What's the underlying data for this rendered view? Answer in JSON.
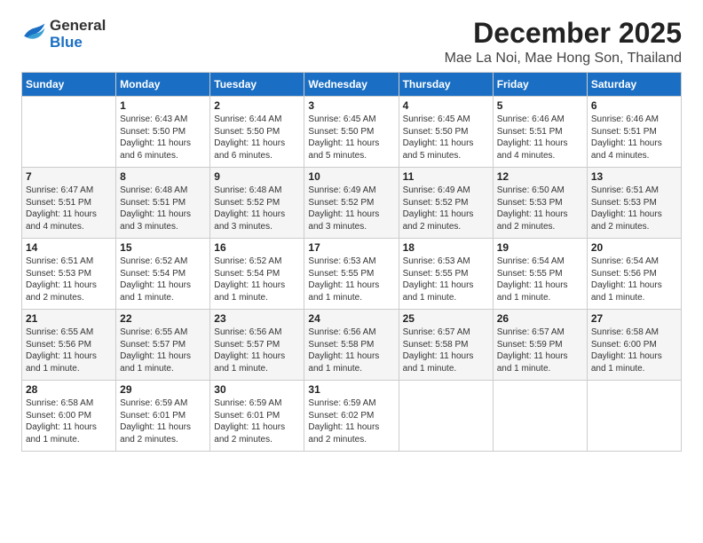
{
  "logo": {
    "general": "General",
    "blue": "Blue"
  },
  "title": "December 2025",
  "location": "Mae La Noi, Mae Hong Son, Thailand",
  "headers": [
    "Sunday",
    "Monday",
    "Tuesday",
    "Wednesday",
    "Thursday",
    "Friday",
    "Saturday"
  ],
  "weeks": [
    [
      {
        "day": "",
        "sunrise": "",
        "sunset": "",
        "daylight": ""
      },
      {
        "day": "1",
        "sunrise": "Sunrise: 6:43 AM",
        "sunset": "Sunset: 5:50 PM",
        "daylight": "Daylight: 11 hours and 6 minutes."
      },
      {
        "day": "2",
        "sunrise": "Sunrise: 6:44 AM",
        "sunset": "Sunset: 5:50 PM",
        "daylight": "Daylight: 11 hours and 6 minutes."
      },
      {
        "day": "3",
        "sunrise": "Sunrise: 6:45 AM",
        "sunset": "Sunset: 5:50 PM",
        "daylight": "Daylight: 11 hours and 5 minutes."
      },
      {
        "day": "4",
        "sunrise": "Sunrise: 6:45 AM",
        "sunset": "Sunset: 5:50 PM",
        "daylight": "Daylight: 11 hours and 5 minutes."
      },
      {
        "day": "5",
        "sunrise": "Sunrise: 6:46 AM",
        "sunset": "Sunset: 5:51 PM",
        "daylight": "Daylight: 11 hours and 4 minutes."
      },
      {
        "day": "6",
        "sunrise": "Sunrise: 6:46 AM",
        "sunset": "Sunset: 5:51 PM",
        "daylight": "Daylight: 11 hours and 4 minutes."
      }
    ],
    [
      {
        "day": "7",
        "sunrise": "Sunrise: 6:47 AM",
        "sunset": "Sunset: 5:51 PM",
        "daylight": "Daylight: 11 hours and 4 minutes."
      },
      {
        "day": "8",
        "sunrise": "Sunrise: 6:48 AM",
        "sunset": "Sunset: 5:51 PM",
        "daylight": "Daylight: 11 hours and 3 minutes."
      },
      {
        "day": "9",
        "sunrise": "Sunrise: 6:48 AM",
        "sunset": "Sunset: 5:52 PM",
        "daylight": "Daylight: 11 hours and 3 minutes."
      },
      {
        "day": "10",
        "sunrise": "Sunrise: 6:49 AM",
        "sunset": "Sunset: 5:52 PM",
        "daylight": "Daylight: 11 hours and 3 minutes."
      },
      {
        "day": "11",
        "sunrise": "Sunrise: 6:49 AM",
        "sunset": "Sunset: 5:52 PM",
        "daylight": "Daylight: 11 hours and 2 minutes."
      },
      {
        "day": "12",
        "sunrise": "Sunrise: 6:50 AM",
        "sunset": "Sunset: 5:53 PM",
        "daylight": "Daylight: 11 hours and 2 minutes."
      },
      {
        "day": "13",
        "sunrise": "Sunrise: 6:51 AM",
        "sunset": "Sunset: 5:53 PM",
        "daylight": "Daylight: 11 hours and 2 minutes."
      }
    ],
    [
      {
        "day": "14",
        "sunrise": "Sunrise: 6:51 AM",
        "sunset": "Sunset: 5:53 PM",
        "daylight": "Daylight: 11 hours and 2 minutes."
      },
      {
        "day": "15",
        "sunrise": "Sunrise: 6:52 AM",
        "sunset": "Sunset: 5:54 PM",
        "daylight": "Daylight: 11 hours and 1 minute."
      },
      {
        "day": "16",
        "sunrise": "Sunrise: 6:52 AM",
        "sunset": "Sunset: 5:54 PM",
        "daylight": "Daylight: 11 hours and 1 minute."
      },
      {
        "day": "17",
        "sunrise": "Sunrise: 6:53 AM",
        "sunset": "Sunset: 5:55 PM",
        "daylight": "Daylight: 11 hours and 1 minute."
      },
      {
        "day": "18",
        "sunrise": "Sunrise: 6:53 AM",
        "sunset": "Sunset: 5:55 PM",
        "daylight": "Daylight: 11 hours and 1 minute."
      },
      {
        "day": "19",
        "sunrise": "Sunrise: 6:54 AM",
        "sunset": "Sunset: 5:55 PM",
        "daylight": "Daylight: 11 hours and 1 minute."
      },
      {
        "day": "20",
        "sunrise": "Sunrise: 6:54 AM",
        "sunset": "Sunset: 5:56 PM",
        "daylight": "Daylight: 11 hours and 1 minute."
      }
    ],
    [
      {
        "day": "21",
        "sunrise": "Sunrise: 6:55 AM",
        "sunset": "Sunset: 5:56 PM",
        "daylight": "Daylight: 11 hours and 1 minute."
      },
      {
        "day": "22",
        "sunrise": "Sunrise: 6:55 AM",
        "sunset": "Sunset: 5:57 PM",
        "daylight": "Daylight: 11 hours and 1 minute."
      },
      {
        "day": "23",
        "sunrise": "Sunrise: 6:56 AM",
        "sunset": "Sunset: 5:57 PM",
        "daylight": "Daylight: 11 hours and 1 minute."
      },
      {
        "day": "24",
        "sunrise": "Sunrise: 6:56 AM",
        "sunset": "Sunset: 5:58 PM",
        "daylight": "Daylight: 11 hours and 1 minute."
      },
      {
        "day": "25",
        "sunrise": "Sunrise: 6:57 AM",
        "sunset": "Sunset: 5:58 PM",
        "daylight": "Daylight: 11 hours and 1 minute."
      },
      {
        "day": "26",
        "sunrise": "Sunrise: 6:57 AM",
        "sunset": "Sunset: 5:59 PM",
        "daylight": "Daylight: 11 hours and 1 minute."
      },
      {
        "day": "27",
        "sunrise": "Sunrise: 6:58 AM",
        "sunset": "Sunset: 6:00 PM",
        "daylight": "Daylight: 11 hours and 1 minute."
      }
    ],
    [
      {
        "day": "28",
        "sunrise": "Sunrise: 6:58 AM",
        "sunset": "Sunset: 6:00 PM",
        "daylight": "Daylight: 11 hours and 1 minute."
      },
      {
        "day": "29",
        "sunrise": "Sunrise: 6:59 AM",
        "sunset": "Sunset: 6:01 PM",
        "daylight": "Daylight: 11 hours and 2 minutes."
      },
      {
        "day": "30",
        "sunrise": "Sunrise: 6:59 AM",
        "sunset": "Sunset: 6:01 PM",
        "daylight": "Daylight: 11 hours and 2 minutes."
      },
      {
        "day": "31",
        "sunrise": "Sunrise: 6:59 AM",
        "sunset": "Sunset: 6:02 PM",
        "daylight": "Daylight: 11 hours and 2 minutes."
      },
      {
        "day": "",
        "sunrise": "",
        "sunset": "",
        "daylight": ""
      },
      {
        "day": "",
        "sunrise": "",
        "sunset": "",
        "daylight": ""
      },
      {
        "day": "",
        "sunrise": "",
        "sunset": "",
        "daylight": ""
      }
    ]
  ]
}
